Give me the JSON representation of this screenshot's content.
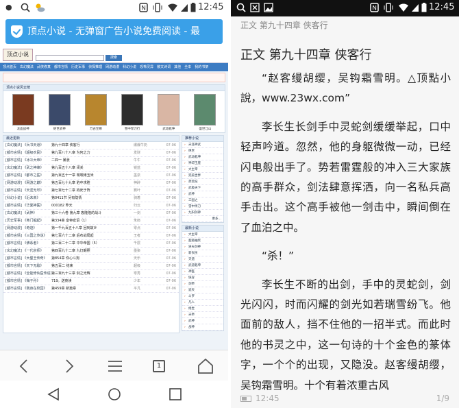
{
  "left_phone": {
    "status_bar": {
      "time": "12:45"
    },
    "banner": {
      "text": "顶点小说 - 无弹窗广告小说免费阅读 - 最"
    },
    "site": {
      "logo": "顶点小说",
      "search_button": "搜索",
      "nav": [
        "顶点首页",
        "玄幻魔法",
        "武侠修真",
        "都市言情",
        "历史军事",
        "侦探推理",
        "网游动漫",
        "科幻小说",
        "恐怖灵异",
        "散文诗词",
        "其他",
        "全本",
        "我的书架"
      ],
      "featured_header": "顶点小说风云榜",
      "featured_books": [
        {
          "title": "龙血战神",
          "color": "#7a3a20"
        },
        {
          "title": "绝世武神",
          "color": "#3b4a6a"
        },
        {
          "title": "万古至尊",
          "color": "#b8862e"
        },
        {
          "title": "雪中悍刀行",
          "color": "#2d2d2d"
        },
        {
          "title": "武动乾坤",
          "color": "#d9b6a4"
        },
        {
          "title": "盛世江山",
          "color": "#5c8a6e"
        }
      ],
      "latest_header": "最近更新",
      "rows": [
        {
          "cat": "[玄幻魔法] 《兵书天道》",
          "chapter": "第九十四章 侠客行",
          "author": "爆爆牛奶",
          "date": "07-06"
        },
        {
          "cat": "[都市言情] 《超级农民》",
          "chapter": "第九百八十八章 为何之力",
          "author": "发财",
          "date": "07-06"
        },
        {
          "cat": "[都市言情] 《冰冷大帝》",
          "chapter": "二四一 暴涨",
          "author": "牛牛",
          "date": "07-06"
        },
        {
          "cat": "[玄幻魔法] 《武之神峰》",
          "chapter": "第九百五十八章 闭关",
          "author": "锐蓝",
          "date": "07-06"
        },
        {
          "cat": "[都市言情] 《都市之医》",
          "chapter": "第九百五十一章 嘿嘿烤玉米",
          "author": "墨泉",
          "date": "07-06"
        },
        {
          "cat": "[网游动漫] 《网游之巅》",
          "chapter": "第五百七十九章 陷中求胜",
          "author": "神醉",
          "date": "07-06"
        },
        {
          "cat": "[都市言情] 《天涯无尽》",
          "chapter": "第七百七十二章 拘死于阵",
          "author": "赛叶",
          "date": "07-06"
        },
        {
          "cat": "[科幻小说] 《近未来》",
          "chapter": "第0411节 另有隐情",
          "author": "骑着",
          "date": "07-06"
        },
        {
          "cat": "[都市言情] 《华夏神医》",
          "chapter": "000182 昨天",
          "author": "归云",
          "date": "07-06"
        },
        {
          "cat": "[玄幻魔法] 《武神》",
          "chapter": "第三十六卷 第九章 轰隆隆的战斗",
          "author": "一剑",
          "date": "07-06"
        },
        {
          "cat": "[历史军事] 《寒门崛起》",
          "chapter": "第334章 皇帝密诏（1）",
          "author": "朱郎",
          "date": "07-06"
        },
        {
          "cat": "[网游动漫] 《奇迹》",
          "chapter": "第一千九百五十八章 回到故乡",
          "author": "零点",
          "date": "07-06"
        },
        {
          "cat": "[都市言情] 《三国之传说》",
          "chapter": "第七百六十二章 后布战局起",
          "author": "王者",
          "date": "07-06"
        },
        {
          "cat": "[都市言情] 《佛系者》",
          "chapter": "第三百二十二章 中华帝国（5）",
          "author": "千层",
          "date": "07-06"
        },
        {
          "cat": "[玄幻魔法] 《一代宗师》",
          "chapter": "第四百九十二章 九灯朗照",
          "author": "墨染",
          "date": "07-06"
        },
        {
          "cat": "[都市言情] 《大蜀王传奇》",
          "chapter": "第854章 你心斗狗",
          "author": "天乐",
          "date": "07-06"
        },
        {
          "cat": "[都市言情] 《天下无敌》",
          "chapter": "第五百二 结束",
          "author": "超级",
          "date": "07-06"
        },
        {
          "cat": "[都市言情] 《全能修仙医传说》",
          "chapter": "第三百九十三章 剑之光辉",
          "author": "零秀",
          "date": "07-06"
        },
        {
          "cat": "[都市言情] 《悔子孙》",
          "chapter": "719。送夜读",
          "author": "少年",
          "date": "07-06"
        },
        {
          "cat": "[都市言情] 《我身在校园》",
          "chapter": "第459章 新篇章",
          "author": "平凡",
          "date": "07-06"
        }
      ],
      "side_header_1": "推荐小说",
      "side_list_1": [
        "天涯神武",
        "绝世",
        "武动乾坤",
        "神印王座",
        "大主宰",
        "完美世界",
        "莽荒纪",
        "武极天下",
        "武神",
        "三国之",
        "雪中悍刀",
        "九阳剑神"
      ],
      "more": "更多…",
      "side_header_2": "最新小说",
      "side_list_2": [
        "大主宰",
        "超级抽奖",
        "逆天剑神",
        "新农民",
        "天道",
        "武道乾坤",
        "神医",
        "快穿",
        "剑帝",
        "遮天",
        "斗罗",
        "凡人",
        "绝世",
        "天帝",
        "武神",
        "战神"
      ]
    },
    "browser": {
      "tabs": "1"
    }
  },
  "right_phone": {
    "status_bar": {
      "time": "12:45"
    },
    "header": "正文 第九十四章 侠客行",
    "chapter_title": "正文 第九十四章 侠客行",
    "paragraphs": [
      "“赵客缦胡缨，吴钩霜雪明。△顶點小說，www.23wx.com”",
      "李长生长剑手中灵蛇剑缓缓举起，口中轻声吟道。忽然，他的身躯微微一动，已经闪电般出手了。势若雷霆般的冲入三大家族的高手群众，剑法肆意挥洒，向一名私兵高手击出。这个高手被他一剑击中，瞬间倒在了血泊之中。",
      "“杀！”",
      "李长生不断的出剑，手中的灵蛇剑，剑光闪闪，时而闪耀的剑光如若瑞雪纷飞。他面前的敌人，挡不住他的一招半式。而此时他的书灵之中，这一句诗的十个金色的篆体字，一个个的出现，又隐没。赵客缦胡缨，吴钩霜雪明。十个有着浓重古风"
    ],
    "footer": {
      "time": "12:45",
      "page": "1/9"
    }
  }
}
